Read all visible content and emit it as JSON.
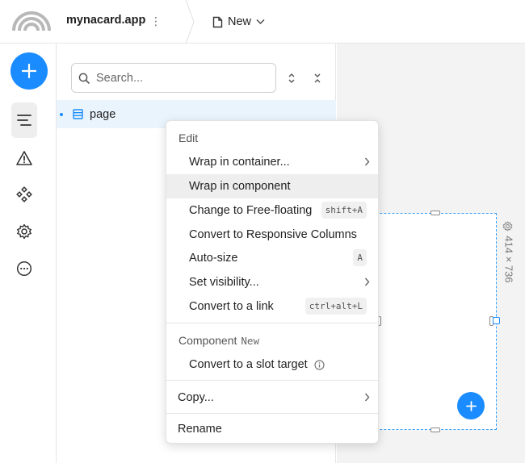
{
  "app": {
    "name": "mynacard.app"
  },
  "header": {
    "page_menu_label": "New"
  },
  "search": {
    "placeholder": "Search..."
  },
  "tree": {
    "items": [
      {
        "label": "page"
      }
    ]
  },
  "frame": {
    "size_label": "414 × 736"
  },
  "context_menu": {
    "edit_header": "Edit",
    "items": [
      {
        "label": "Wrap in container...",
        "submenu": true
      },
      {
        "label": "Wrap in component",
        "highlighted": true
      },
      {
        "label": "Change to Free-floating",
        "shortcut": "shift+A"
      },
      {
        "label": "Convert to Responsive Columns"
      },
      {
        "label": "Auto-size",
        "shortcut": "A"
      },
      {
        "label": "Set visibility...",
        "submenu": true
      },
      {
        "label": "Convert to a link",
        "shortcut": "ctrl+alt+L"
      }
    ],
    "component_header": "Component",
    "component_badge": "New",
    "slot_label": "Convert to a slot target",
    "copy_label": "Copy...",
    "rename_label": "Rename"
  },
  "colors": {
    "accent": "#1a8cff",
    "selection_bg": "#eaf4fd",
    "hover_bg": "#eeeeee"
  }
}
